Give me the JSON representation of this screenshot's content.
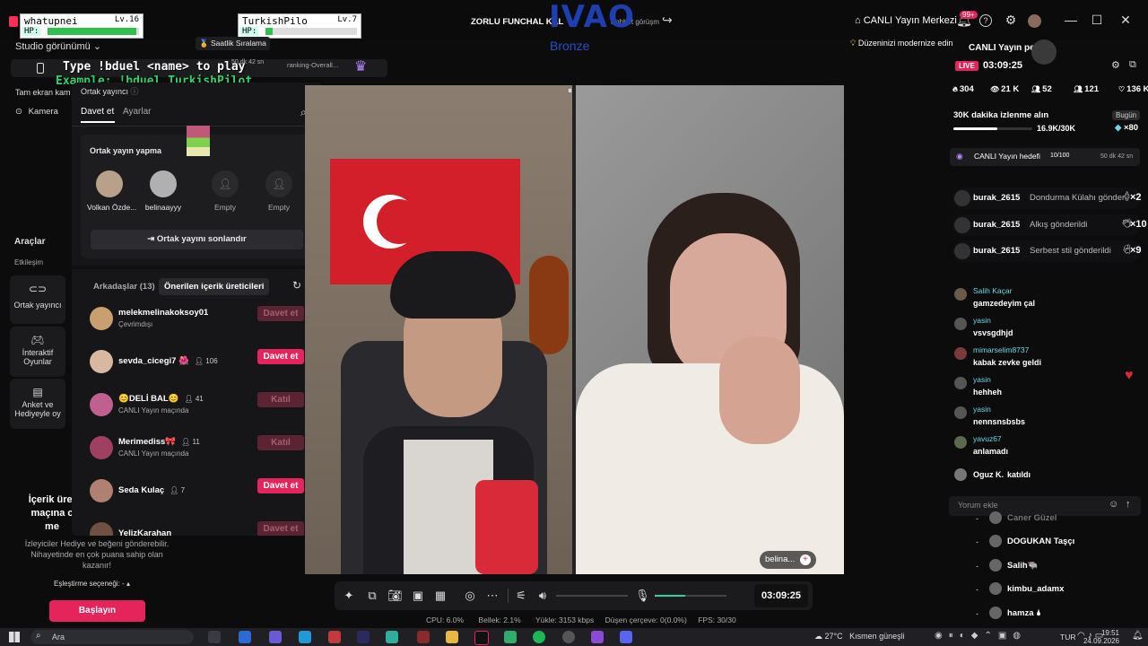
{
  "overlay": {
    "player1": {
      "name": "whatupnei",
      "level": "Lv.16",
      "hp_label": "HP:",
      "hp_fraction": 0.97
    },
    "player2": {
      "name": "TurkishPilo",
      "level": "Lv.7",
      "hp_label": "HP:",
      "hp_fraction": 0.08
    },
    "command_line1": "Type !bduel <name> to play",
    "command_line2": "Example: !bduel TurkishPilot",
    "brand_name": "IVAO",
    "brand_rank": "Bronze",
    "hourly_rank": "Saatlik Sıralama",
    "timer_small": "50 dk 42 sn",
    "ranking_overall": "ranking-Overall..."
  },
  "topbar": {
    "title": "ZORLU FUNCHAL KAL",
    "title_suffix": "Sohbet görüşm",
    "live_center": "CANLI Yayın Merkezi",
    "notif_badge": "99+"
  },
  "left": {
    "studio_view": "Studio görünümü",
    "fullscreen": "Tam ekran kam",
    "camera": "Kamera",
    "tools": "Araçlar",
    "interaction": "Etkileşim",
    "btn_cohost": "Ortak yayıncı",
    "btn_games": "İnteraktif Oyunlar",
    "btn_poll": "Anket ve Hediyeyle oy",
    "promo_title1": "İçerik üret",
    "promo_title2": "maçına c",
    "promo_title3": "me",
    "promo_desc": "İzleyiciler Hediye ve beğeni gönderebilir. Nihayetinde en çok puana sahip olan kazanır!",
    "match_option": "Eşleştirme seçeneği: -",
    "start_btn": "Başlayın"
  },
  "panel": {
    "title": "Ortak yayıncı",
    "tab_invite": "Davet et",
    "tab_settings": "Ayarlar",
    "cohosting_label": "Ortak yayın yapma",
    "slots": [
      {
        "name": "Volkan Özde..."
      },
      {
        "name": "belinaayyy"
      },
      {
        "name": "Empty"
      },
      {
        "name": "Empty"
      }
    ],
    "end_btn": "Ortak yayını sonlandır",
    "friends_tab": "Arkadaşlar (13)",
    "suggested_tab": "Önerilen içerik üreticileri",
    "list": [
      {
        "name": "melekmelinakoksoy01",
        "sub": "Çevrimdışı",
        "count": "",
        "action": "Davet et",
        "active": false
      },
      {
        "name": "sevda_cicegi7 🌺",
        "sub": "",
        "count": "106",
        "action": "Davet et",
        "active": true
      },
      {
        "name": "😊DELİ BAL😊",
        "sub": "CANLI Yayın maçında",
        "count": "41",
        "action": "Katıl",
        "active": false
      },
      {
        "name": "Merimediss🎀",
        "sub": "CANLI Yayın maçında",
        "count": "11",
        "action": "Katıl",
        "active": false
      },
      {
        "name": "Seda Kulaç",
        "sub": "",
        "count": "7",
        "action": "Davet et",
        "active": true
      },
      {
        "name": "YelizKarahan",
        "sub": "",
        "count": "",
        "action": "Davet et",
        "active": false
      }
    ]
  },
  "video": {
    "guest_name": "belina...",
    "timer": "03:09:25"
  },
  "right": {
    "modernize_tip": "Düzeninizi modernize edin",
    "live_badge": "LIVE",
    "live_time": "03:09:25",
    "header_partial": "CANLI Yayın pe",
    "stats": [
      {
        "icon": "fire",
        "value": "304"
      },
      {
        "icon": "eye",
        "value": "21 K"
      },
      {
        "icon": "people",
        "value": "52"
      },
      {
        "icon": "people",
        "value": "121"
      },
      {
        "icon": "heart",
        "value": "136 K"
      }
    ],
    "watch_goal": "30K dakika izlenme alın",
    "today": "Bugün",
    "watch_progress": "16.9K/30K",
    "watch_fraction": 0.56,
    "gift_count": "×80",
    "goal_label": "CANLI Yayın hedefi",
    "goal_progress": "10/100",
    "goal_timer": "50 dk 42 sn",
    "gifts": [
      {
        "user": "burak_2615",
        "text": "Dondurma Külahı gönder",
        "count": "×2"
      },
      {
        "user": "burak_2615",
        "text": "Alkış gönderildi",
        "count": "×10"
      },
      {
        "user": "burak_2615",
        "text": "Serbest stil gönderildi",
        "count": "×9"
      }
    ],
    "chat": [
      {
        "user": "Salih Kaçar",
        "text": "gamzedeyim çal"
      },
      {
        "user": "yasin",
        "text": "vsvsgdhjd"
      },
      {
        "user": "mimarselim8737",
        "text": "kabak zevke geldi"
      },
      {
        "user": "yasin",
        "text": "hehheh"
      },
      {
        "user": "yasin",
        "text": "nennsnsbsbs"
      },
      {
        "user": "yavuz67",
        "text": "anlamadı"
      },
      {
        "user": "Oguz K.",
        "text": "katıldı"
      }
    ],
    "comment_placeholder": "Yorum ekle",
    "viewers": [
      {
        "name": "Caner Güzel"
      },
      {
        "name": "DOGUKAN Taşçı"
      },
      {
        "name": "Salih🐃"
      },
      {
        "name": "kimbu_adamx"
      },
      {
        "name": "hamza 🌢"
      }
    ]
  },
  "controls": {
    "volume_fraction": 0.0,
    "mic_fraction": 0.42,
    "timer": "03:09:25"
  },
  "stats": {
    "cpu": "CPU: 6.0%",
    "memory": "Bellek: 2.1%",
    "upload": "Yükle: 3153 kbps",
    "dropped": "Düşen çerçeve: 0(0.0%)",
    "fps": "FPS: 30/30"
  },
  "taskbar": {
    "search": "Ara",
    "weather": "27°C",
    "weather_text": "Kısmen güneşli",
    "lang": "TUR",
    "time": "19:51",
    "date": "24.09.2026"
  }
}
